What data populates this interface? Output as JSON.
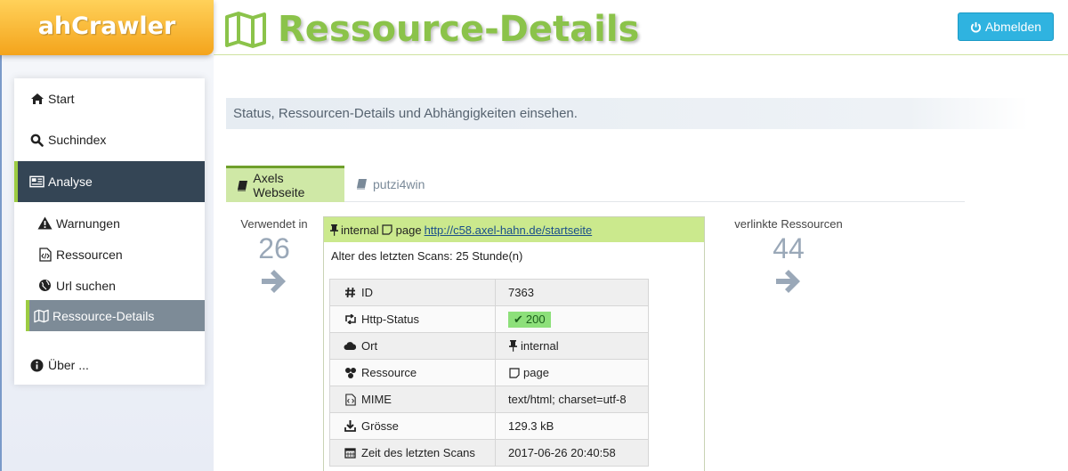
{
  "brand": "ahCrawler",
  "header": {
    "title": "Ressource-Details",
    "logout_label": "Abmelden"
  },
  "sidebar": {
    "items": [
      {
        "label": "Start",
        "icon": "home-icon"
      },
      {
        "label": "Suchindex",
        "icon": "search-icon"
      },
      {
        "label": "Analyse",
        "icon": "newspaper-icon"
      },
      {
        "label": "Über ...",
        "icon": "info-icon"
      }
    ],
    "subitems": [
      {
        "label": "Warnungen",
        "icon": "warning-icon"
      },
      {
        "label": "Ressourcen",
        "icon": "code-file-icon"
      },
      {
        "label": "Url suchen",
        "icon": "globe-icon"
      },
      {
        "label": "Ressource-Details",
        "icon": "map-icon"
      }
    ]
  },
  "main": {
    "subtitle": "Status, Ressourcen-Details und Abhängigkeiten einsehen.",
    "tabs": [
      {
        "label": "Axels Webseite"
      },
      {
        "label": "putzi4win"
      }
    ],
    "used_in": {
      "label": "Verwendet in",
      "count": "26"
    },
    "linked": {
      "label": "verlinkte Ressourcen",
      "count": "44"
    },
    "resource": {
      "location": "internal",
      "type": "page",
      "url": "http://c58.axel-hahn.de/startseite",
      "age_text": "Alter des letzten Scans: 25 Stunde(n)"
    },
    "details": [
      {
        "label": "ID",
        "value": "7363",
        "icon": "hash-icon"
      },
      {
        "label": "Http-Status",
        "value": "200",
        "icon": "retweet-icon"
      },
      {
        "label": "Ort",
        "value": "internal",
        "icon": "cloud-icon"
      },
      {
        "label": "Ressource",
        "value": "page",
        "icon": "cubes-icon"
      },
      {
        "label": "MIME",
        "value": "text/html; charset=utf-8",
        "icon": "code-file-icon"
      },
      {
        "label": "Grösse",
        "value": "129.3 kB",
        "icon": "download-icon"
      },
      {
        "label": "Zeit des letzten Scans",
        "value": "2017-06-26 20:40:58",
        "icon": "calendar-icon"
      }
    ]
  },
  "colors": {
    "brand": "#f4a41c",
    "accent_green": "#8bc34a",
    "logout_blue": "#2fb3e0",
    "active_dark": "#344555"
  }
}
